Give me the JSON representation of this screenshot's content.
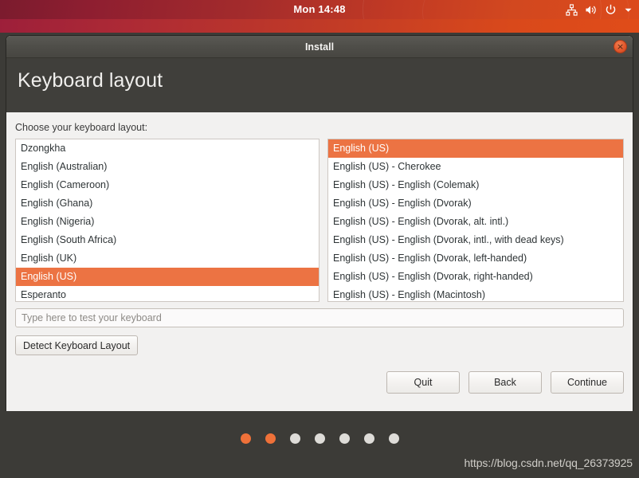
{
  "topbar": {
    "clock": "Mon 14:48",
    "tray_icons": [
      "network-icon",
      "volume-icon",
      "power-icon",
      "chevron-down-icon"
    ]
  },
  "window": {
    "title": "Install",
    "close_label": "×"
  },
  "page": {
    "title": "Keyboard layout",
    "choose_label": "Choose your keyboard layout:"
  },
  "layout_list": {
    "selected": "English (US)",
    "items": [
      "Dzongkha",
      "English (Australian)",
      "English (Cameroon)",
      "English (Ghana)",
      "English (Nigeria)",
      "English (South Africa)",
      "English (UK)",
      "English (US)",
      "Esperanto"
    ]
  },
  "variant_list": {
    "selected": "English (US)",
    "items": [
      "English (US)",
      "English (US) - Cherokee",
      "English (US) - English (Colemak)",
      "English (US) - English (Dvorak)",
      "English (US) - English (Dvorak, alt. intl.)",
      "English (US) - English (Dvorak, intl., with dead keys)",
      "English (US) - English (Dvorak, left-handed)",
      "English (US) - English (Dvorak, right-handed)",
      "English (US) - English (Macintosh)"
    ]
  },
  "test_input": {
    "value": "",
    "placeholder": "Type here to test your keyboard"
  },
  "buttons": {
    "detect": "Detect Keyboard Layout",
    "quit": "Quit",
    "back": "Back",
    "continue": "Continue"
  },
  "footer": {
    "dots_total": 7,
    "dots_active": 2,
    "watermark": "https://blog.csdn.net/qq_26373925"
  },
  "colors": {
    "accent_orange": "#ec7343",
    "dot_active": "#ef7139",
    "dot_inactive": "#dedcd8",
    "header_dark": "#403f3b",
    "footer_dark": "#3c3b37",
    "content_bg": "#f2f1f0"
  }
}
